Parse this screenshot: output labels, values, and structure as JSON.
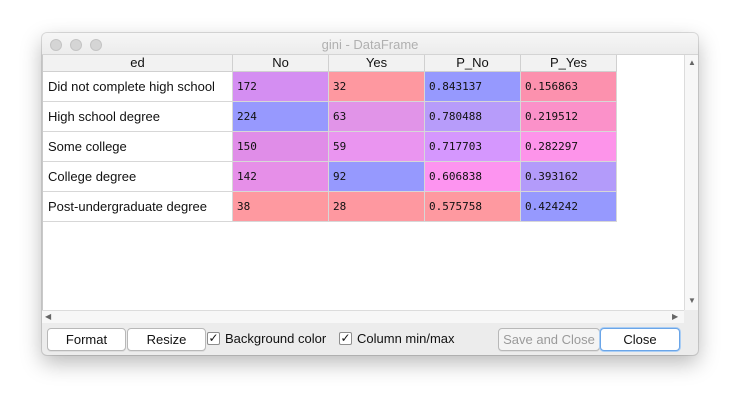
{
  "window": {
    "title": "gini - DataFrame"
  },
  "table": {
    "index_header": "ed",
    "columns": [
      "No",
      "Yes",
      "P_No",
      "P_Yes"
    ],
    "rows": [
      {
        "label": "Did not complete high school",
        "values": [
          "172",
          "32",
          "0.843137",
          "0.156863"
        ],
        "colors": [
          "#d48ef2",
          "#fe98a0",
          "#9699fe",
          "#fc91ae"
        ]
      },
      {
        "label": "High school degree",
        "values": [
          "224",
          "63",
          "0.780488",
          "0.219512"
        ],
        "colors": [
          "#9799fe",
          "#e194e8",
          "#b79cfa",
          "#fb91c9"
        ]
      },
      {
        "label": "Some college",
        "values": [
          "150",
          "59",
          "0.717703",
          "0.282297"
        ],
        "colors": [
          "#e08de8",
          "#ea95f0",
          "#d597fe",
          "#fd94ea"
        ]
      },
      {
        "label": "College degree",
        "values": [
          "142",
          "92",
          "0.606838",
          "0.393162"
        ],
        "colors": [
          "#e68fe8",
          "#9699fe",
          "#fd94f0",
          "#b39bfa"
        ]
      },
      {
        "label": "Post-undergraduate degree",
        "values": [
          "38",
          "28",
          "0.575758",
          "0.424242"
        ],
        "colors": [
          "#fe99a0",
          "#fe98a0",
          "#fe99a0",
          "#9699fe"
        ]
      }
    ]
  },
  "buttons": {
    "format": "Format",
    "resize": "Resize",
    "save_close": "Save and Close",
    "close": "Close"
  },
  "checkboxes": {
    "background_color": {
      "label": "Background color",
      "checked": true,
      "mark": "✓"
    },
    "column_minmax": {
      "label": "Column min/max",
      "checked": true,
      "mark": "✓"
    }
  },
  "scroll_arrows": {
    "up": "▲",
    "down": "▼",
    "left": "◀",
    "right": "▶"
  }
}
